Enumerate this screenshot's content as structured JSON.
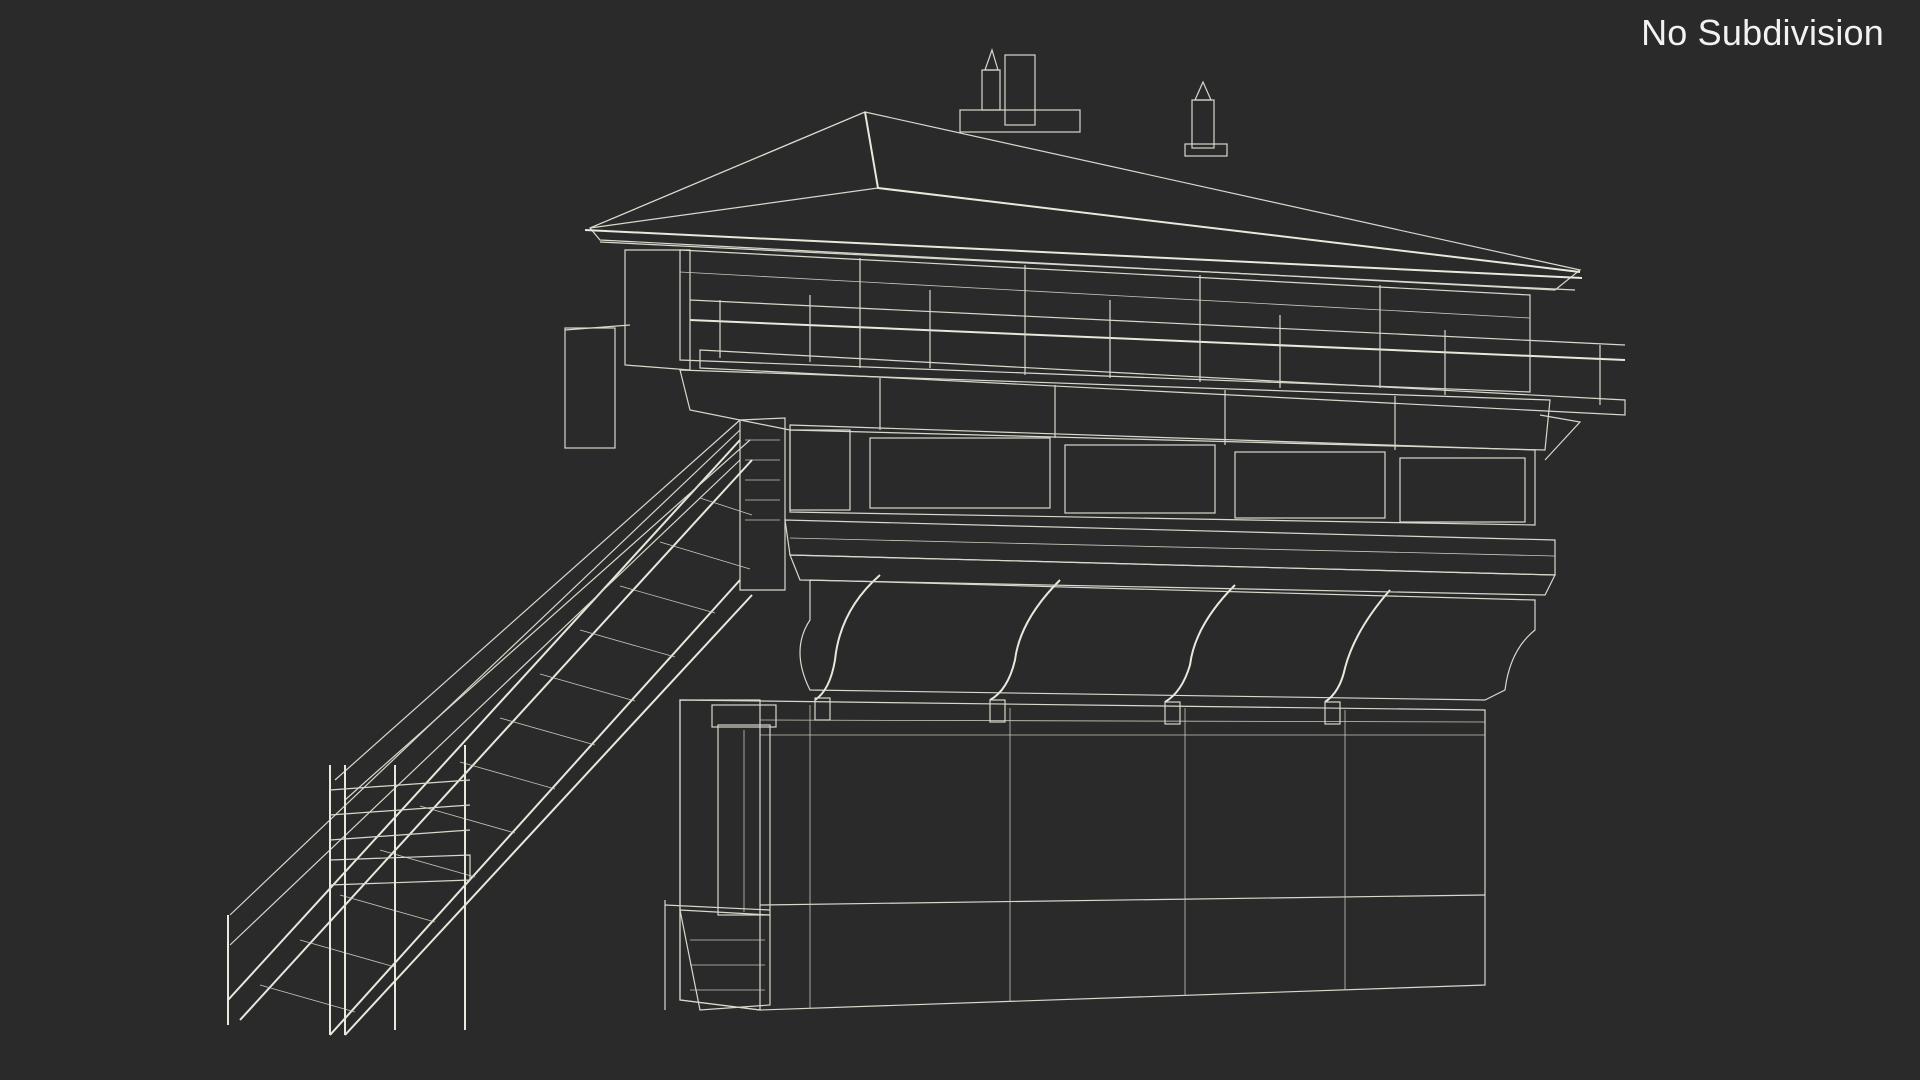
{
  "viewport": {
    "label": "No Subdivision",
    "background_color": "#2a2a2a",
    "wireframe_color": "#d8d8cc",
    "surface_color": "#7a7a6e"
  },
  "model": {
    "icon": "railway-signal-box-wireframe"
  }
}
